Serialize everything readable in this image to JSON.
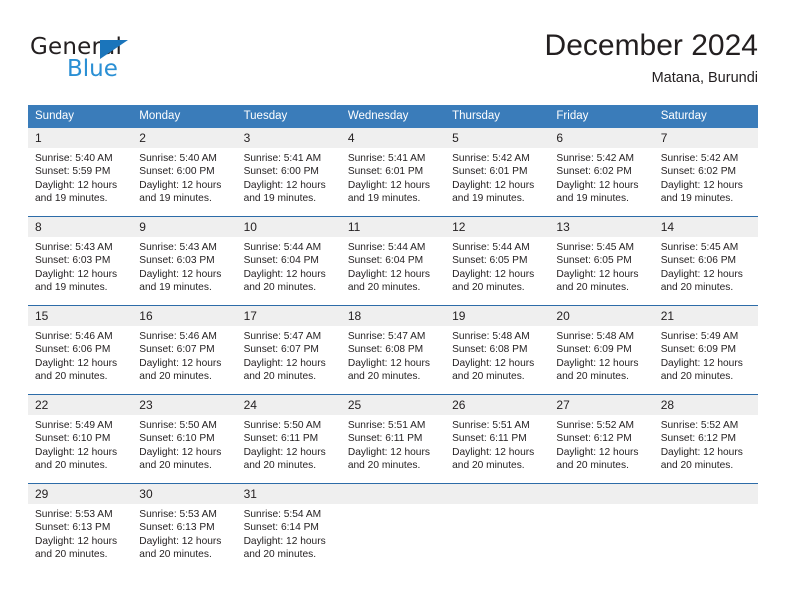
{
  "logo": {
    "word_one": "General",
    "word_two": "Blue",
    "triangle_icon": "triangle-icon",
    "accent_color": "#1b75bb",
    "blue_text_color": "#2a8fd4"
  },
  "header": {
    "title": "December 2024",
    "subtitle": "Matana, Burundi"
  },
  "colors": {
    "header_row_bg": "#3a7cba",
    "header_row_text": "#ffffff",
    "daynum_bg": "#efefef",
    "row_divider": "#2d6ca8",
    "body_text": "#231f20"
  },
  "weekdays": [
    "Sunday",
    "Monday",
    "Tuesday",
    "Wednesday",
    "Thursday",
    "Friday",
    "Saturday"
  ],
  "weeks": [
    [
      {
        "day": "1",
        "sunrise": "Sunrise: 5:40 AM",
        "sunset": "Sunset: 5:59 PM",
        "daylight": "Daylight: 12 hours and 19 minutes."
      },
      {
        "day": "2",
        "sunrise": "Sunrise: 5:40 AM",
        "sunset": "Sunset: 6:00 PM",
        "daylight": "Daylight: 12 hours and 19 minutes."
      },
      {
        "day": "3",
        "sunrise": "Sunrise: 5:41 AM",
        "sunset": "Sunset: 6:00 PM",
        "daylight": "Daylight: 12 hours and 19 minutes."
      },
      {
        "day": "4",
        "sunrise": "Sunrise: 5:41 AM",
        "sunset": "Sunset: 6:01 PM",
        "daylight": "Daylight: 12 hours and 19 minutes."
      },
      {
        "day": "5",
        "sunrise": "Sunrise: 5:42 AM",
        "sunset": "Sunset: 6:01 PM",
        "daylight": "Daylight: 12 hours and 19 minutes."
      },
      {
        "day": "6",
        "sunrise": "Sunrise: 5:42 AM",
        "sunset": "Sunset: 6:02 PM",
        "daylight": "Daylight: 12 hours and 19 minutes."
      },
      {
        "day": "7",
        "sunrise": "Sunrise: 5:42 AM",
        "sunset": "Sunset: 6:02 PM",
        "daylight": "Daylight: 12 hours and 19 minutes."
      }
    ],
    [
      {
        "day": "8",
        "sunrise": "Sunrise: 5:43 AM",
        "sunset": "Sunset: 6:03 PM",
        "daylight": "Daylight: 12 hours and 19 minutes."
      },
      {
        "day": "9",
        "sunrise": "Sunrise: 5:43 AM",
        "sunset": "Sunset: 6:03 PM",
        "daylight": "Daylight: 12 hours and 19 minutes."
      },
      {
        "day": "10",
        "sunrise": "Sunrise: 5:44 AM",
        "sunset": "Sunset: 6:04 PM",
        "daylight": "Daylight: 12 hours and 20 minutes."
      },
      {
        "day": "11",
        "sunrise": "Sunrise: 5:44 AM",
        "sunset": "Sunset: 6:04 PM",
        "daylight": "Daylight: 12 hours and 20 minutes."
      },
      {
        "day": "12",
        "sunrise": "Sunrise: 5:44 AM",
        "sunset": "Sunset: 6:05 PM",
        "daylight": "Daylight: 12 hours and 20 minutes."
      },
      {
        "day": "13",
        "sunrise": "Sunrise: 5:45 AM",
        "sunset": "Sunset: 6:05 PM",
        "daylight": "Daylight: 12 hours and 20 minutes."
      },
      {
        "day": "14",
        "sunrise": "Sunrise: 5:45 AM",
        "sunset": "Sunset: 6:06 PM",
        "daylight": "Daylight: 12 hours and 20 minutes."
      }
    ],
    [
      {
        "day": "15",
        "sunrise": "Sunrise: 5:46 AM",
        "sunset": "Sunset: 6:06 PM",
        "daylight": "Daylight: 12 hours and 20 minutes."
      },
      {
        "day": "16",
        "sunrise": "Sunrise: 5:46 AM",
        "sunset": "Sunset: 6:07 PM",
        "daylight": "Daylight: 12 hours and 20 minutes."
      },
      {
        "day": "17",
        "sunrise": "Sunrise: 5:47 AM",
        "sunset": "Sunset: 6:07 PM",
        "daylight": "Daylight: 12 hours and 20 minutes."
      },
      {
        "day": "18",
        "sunrise": "Sunrise: 5:47 AM",
        "sunset": "Sunset: 6:08 PM",
        "daylight": "Daylight: 12 hours and 20 minutes."
      },
      {
        "day": "19",
        "sunrise": "Sunrise: 5:48 AM",
        "sunset": "Sunset: 6:08 PM",
        "daylight": "Daylight: 12 hours and 20 minutes."
      },
      {
        "day": "20",
        "sunrise": "Sunrise: 5:48 AM",
        "sunset": "Sunset: 6:09 PM",
        "daylight": "Daylight: 12 hours and 20 minutes."
      },
      {
        "day": "21",
        "sunrise": "Sunrise: 5:49 AM",
        "sunset": "Sunset: 6:09 PM",
        "daylight": "Daylight: 12 hours and 20 minutes."
      }
    ],
    [
      {
        "day": "22",
        "sunrise": "Sunrise: 5:49 AM",
        "sunset": "Sunset: 6:10 PM",
        "daylight": "Daylight: 12 hours and 20 minutes."
      },
      {
        "day": "23",
        "sunrise": "Sunrise: 5:50 AM",
        "sunset": "Sunset: 6:10 PM",
        "daylight": "Daylight: 12 hours and 20 minutes."
      },
      {
        "day": "24",
        "sunrise": "Sunrise: 5:50 AM",
        "sunset": "Sunset: 6:11 PM",
        "daylight": "Daylight: 12 hours and 20 minutes."
      },
      {
        "day": "25",
        "sunrise": "Sunrise: 5:51 AM",
        "sunset": "Sunset: 6:11 PM",
        "daylight": "Daylight: 12 hours and 20 minutes."
      },
      {
        "day": "26",
        "sunrise": "Sunrise: 5:51 AM",
        "sunset": "Sunset: 6:11 PM",
        "daylight": "Daylight: 12 hours and 20 minutes."
      },
      {
        "day": "27",
        "sunrise": "Sunrise: 5:52 AM",
        "sunset": "Sunset: 6:12 PM",
        "daylight": "Daylight: 12 hours and 20 minutes."
      },
      {
        "day": "28",
        "sunrise": "Sunrise: 5:52 AM",
        "sunset": "Sunset: 6:12 PM",
        "daylight": "Daylight: 12 hours and 20 minutes."
      }
    ],
    [
      {
        "day": "29",
        "sunrise": "Sunrise: 5:53 AM",
        "sunset": "Sunset: 6:13 PM",
        "daylight": "Daylight: 12 hours and 20 minutes."
      },
      {
        "day": "30",
        "sunrise": "Sunrise: 5:53 AM",
        "sunset": "Sunset: 6:13 PM",
        "daylight": "Daylight: 12 hours and 20 minutes."
      },
      {
        "day": "31",
        "sunrise": "Sunrise: 5:54 AM",
        "sunset": "Sunset: 6:14 PM",
        "daylight": "Daylight: 12 hours and 20 minutes."
      },
      {
        "day": "",
        "sunrise": "",
        "sunset": "",
        "daylight": ""
      },
      {
        "day": "",
        "sunrise": "",
        "sunset": "",
        "daylight": ""
      },
      {
        "day": "",
        "sunrise": "",
        "sunset": "",
        "daylight": ""
      },
      {
        "day": "",
        "sunrise": "",
        "sunset": "",
        "daylight": ""
      }
    ]
  ]
}
